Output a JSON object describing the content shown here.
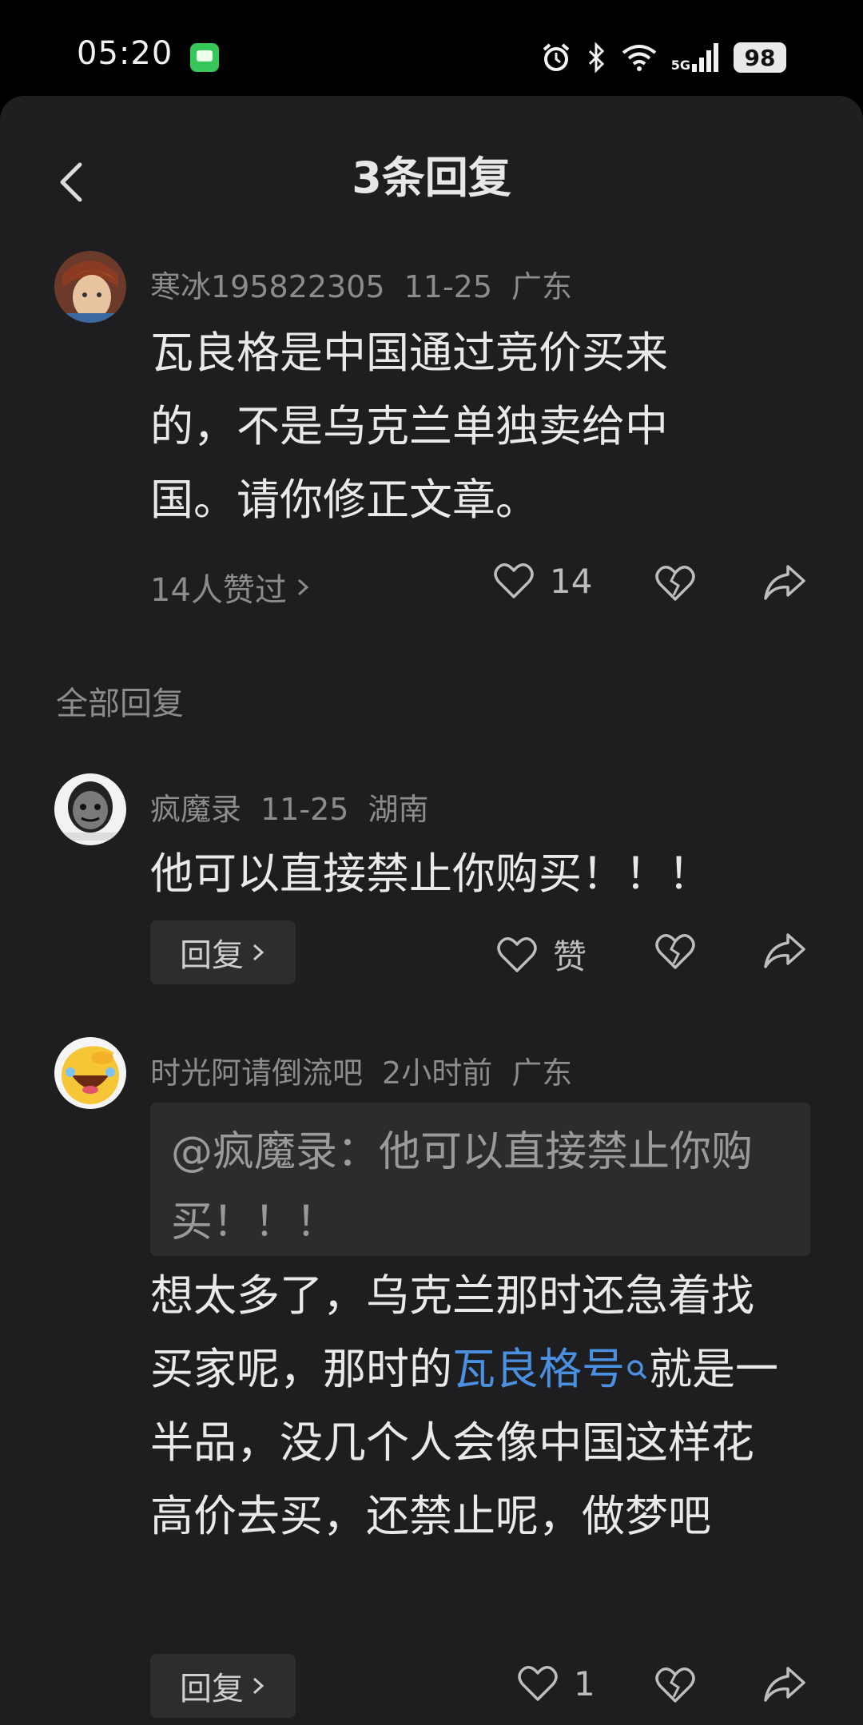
{
  "status_bar": {
    "time": "05:20",
    "battery": "98",
    "network": "5G"
  },
  "header": {
    "title": "3条回复"
  },
  "main_comment": {
    "user": "寒冰195822305",
    "date": "11-25",
    "location": "广东",
    "text": "瓦良格是中国通过竞价买来的，不是乌克兰单独卖给中国。请你修正文章。",
    "likes_link": "14人赞过",
    "like_count": "14"
  },
  "section_label": "全部回复",
  "replies": [
    {
      "user": "疯魔录",
      "date": "11-25",
      "location": "湖南",
      "text": "他可以直接禁止你购买！！！",
      "reply_label": "回复",
      "like_label": "赞"
    },
    {
      "user": "时光阿请倒流吧",
      "date": "2小时前",
      "location": "广东",
      "quote": "@疯魔录：他可以直接禁止你购买！！！",
      "text_before": "想太多了，乌克兰那时还急着找买家呢，那时的",
      "link": "瓦良格号",
      "text_after": "就是一半品，没几个人会像中国这样花高价去买，还禁止呢，做梦吧",
      "reply_label": "回复",
      "like_count": "1"
    }
  ],
  "icons": [
    "back-icon",
    "heart-icon",
    "broken-heart-icon",
    "share-icon",
    "search-icon",
    "chevron-right-icon",
    "alarm-icon",
    "bluetooth-icon",
    "wifi-icon",
    "signal-icon",
    "message-icon"
  ]
}
